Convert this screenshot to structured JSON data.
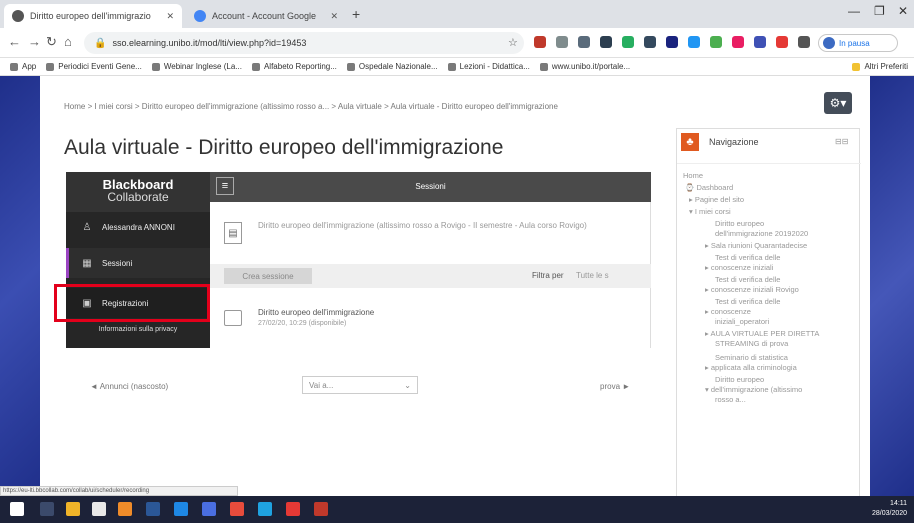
{
  "browser": {
    "tabs": [
      {
        "title": "Diritto europeo dell'immigrazio"
      },
      {
        "title": "Account - Account Google"
      }
    ],
    "new_tab_label": "+",
    "url": "sso.elearning.unibo.it/mod/lti/view.php?id=19453",
    "profile_label": "In pausa",
    "bookmarks": [
      "App",
      "Periodici Eventi Gene...",
      "Webinar Inglese (La...",
      "Alfabeto Reporting...",
      "Ospedale Nazionale...",
      "Lezioni - Didattica...",
      "www.unibo.it/portale..."
    ],
    "other_bookmarks": "Altri Preferiti"
  },
  "page": {
    "breadcrumb": "Home > I miei corsi > Diritto europeo dell'immigrazione (altissimo rosso a... > Aula virtuale > Aula virtuale - Diritto europeo dell'immigrazione",
    "title": "Aula virtuale - Diritto europeo dell'immigrazione",
    "gear_icon": "gear-icon"
  },
  "collaborate": {
    "logo_line1": "Blackboard",
    "logo_line2": "Collaborate",
    "user": "Alessandra ANNONI",
    "nav_sessions": "Sessioni",
    "nav_recordings": "Registrazioni",
    "info_link": "Informazioni sulla privacy",
    "header_title": "Sessioni",
    "course_name": "Diritto europeo dell'immigrazione (altissimo rosso a Rovigo - II semestre - Aula corso Rovigo)",
    "create_button": "Crea sessione",
    "filter_label": "Filtra per",
    "filter_value": "Tutte le s",
    "recording_title": "Diritto europeo dell'immigrazione",
    "recording_date": "27/02/20, 10:29 (disponibile)"
  },
  "pager": {
    "prev": "◄ Annunci (nascosto)",
    "jump_placeholder": "Vai a...",
    "next": "prova ►"
  },
  "navigation": {
    "title": "Navigazione",
    "items": [
      "Home",
      "Dashboard",
      "Pagine del sito",
      "I miei corsi",
      "Diritto europeo",
      "dell'immigrazione 20192020",
      "Sala riunioni Quarantadecise",
      "Test di verifica delle",
      "conoscenze iniziali",
      "Test di verifica delle",
      "conoscenze iniziali Rovigo",
      "Test di verifica delle",
      "conoscenze",
      "iniziali_operatori",
      "AULA VIRTUALE PER DIRETTA",
      "STREAMING di prova",
      "Seminario di statistica",
      "applicata alla criminologia",
      "Diritto europeo",
      "dell'immigrazione (altissimo",
      "rosso a..."
    ]
  },
  "status_url": "https://eu-lti.bbcollab.com/collab/ui/scheduler/recording",
  "clock": {
    "time": "14:11",
    "date": "28/03/2020"
  },
  "colors": {
    "collab_dark": "#262626",
    "highlight": "#e3001b",
    "page_bg": "#2f3d96",
    "accent_purple": "#9a44c2"
  }
}
